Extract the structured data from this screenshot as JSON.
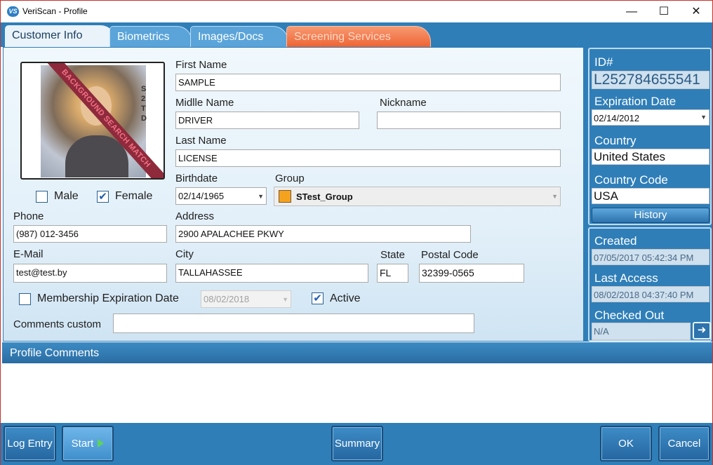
{
  "window": {
    "title": "VeriScan - Profile",
    "app_icon": "VS",
    "minimize_glyph": "—",
    "maximize_glyph": "☐",
    "close_glyph": "✕"
  },
  "tabs": [
    {
      "label": "Customer Info",
      "active": true
    },
    {
      "label": "Biometrics",
      "active": false
    },
    {
      "label": "Images/Docs",
      "active": false
    },
    {
      "label": "Screening Services",
      "active": false
    }
  ],
  "photo": {
    "banner": "BACKGROUND SEARCH MATCH",
    "side_text": "S 2 T D"
  },
  "gender": {
    "male_label": "Male",
    "male_checked": false,
    "female_label": "Female",
    "female_checked": true
  },
  "form": {
    "first_name": {
      "label": "First Name",
      "value": "SAMPLE"
    },
    "middle_name": {
      "label": "Midlle Name",
      "value": "DRIVER"
    },
    "nickname": {
      "label": "Nickname",
      "value": ""
    },
    "last_name": {
      "label": "Last Name",
      "value": "LICENSE"
    },
    "birthdate": {
      "label": "Birthdate",
      "value": "02/14/1965"
    },
    "group": {
      "label": "Group",
      "value": "STest_Group",
      "color": "#f5a21f"
    },
    "phone": {
      "label": "Phone",
      "value": "(987) 012-3456"
    },
    "address": {
      "label": "Address",
      "value": "2900 APALACHEE PKWY"
    },
    "email": {
      "label": "E-Mail",
      "value": "test@test.by"
    },
    "city": {
      "label": "City",
      "value": "TALLAHASSEE"
    },
    "state": {
      "label": "State",
      "value": "FL"
    },
    "postal_code": {
      "label": "Postal Code",
      "value": "32399-0565"
    },
    "membership": {
      "label": "Membership Expiration Date",
      "checked": false,
      "value": "08/02/2018"
    },
    "active": {
      "label": "Active",
      "checked": true
    },
    "comments_custom": {
      "label": "Comments custom",
      "value": ""
    }
  },
  "right_panel": {
    "id_label": "ID#",
    "id_value": "L252784655541",
    "expiration_label": "Expiration Date",
    "expiration_value": "02/14/2012",
    "country_label": "Country",
    "country_value": "United States",
    "country_code_label": "Country Code",
    "country_code_value": "USA",
    "history_button": "History",
    "created_label": "Created",
    "created_value": "07/05/2017 05:42:34 PM",
    "last_access_label": "Last Access",
    "last_access_value": "08/02/2018 04:37:40 PM",
    "checked_out_label": "Checked Out",
    "checked_out_value": "N/A"
  },
  "profile_comments": {
    "title": "Profile Comments",
    "value": ""
  },
  "footer": {
    "log_entry": "Log Entry",
    "start": "Start",
    "summary": "Summary",
    "ok": "OK",
    "cancel": "Cancel"
  },
  "colors": {
    "primary_blue": "#2f7eb8",
    "screening_tab": "#ee6231",
    "check_blue": "#1d5fb0",
    "banner": "#8e2a3b"
  }
}
